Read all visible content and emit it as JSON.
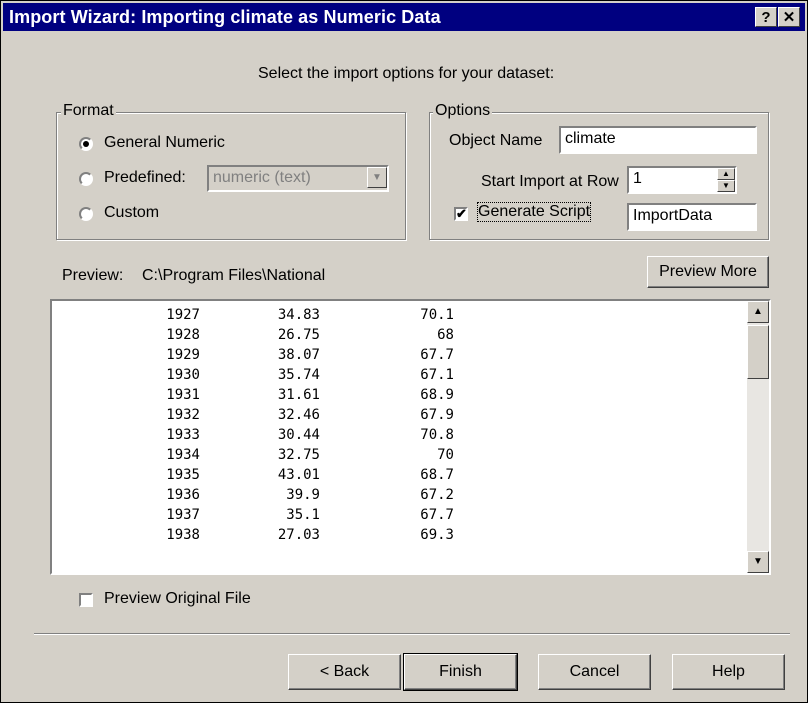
{
  "window": {
    "title": "Import Wizard: Importing climate as Numeric Data",
    "help_button": "?",
    "close_button": "✕"
  },
  "instructions": "Select the import options for your dataset:",
  "format": {
    "group_label": "Format",
    "options": [
      {
        "label": "General Numeric",
        "selected": true
      },
      {
        "label": "Predefined:",
        "selected": false
      },
      {
        "label": "Custom",
        "selected": false
      }
    ],
    "predefined_value": "numeric (text)"
  },
  "options": {
    "group_label": "Options",
    "object_name_label": "Object Name",
    "object_name_value": "climate",
    "start_row_label": "Start Import at Row",
    "start_row_value": "1",
    "generate_script_label": "Generate Script",
    "generate_script_checked": true,
    "script_name_value": "ImportData"
  },
  "preview": {
    "label": "Preview:",
    "path": "C:\\Program Files\\National",
    "more_button": "Preview More",
    "rows": [
      [
        "1927",
        "34.83",
        "70.1"
      ],
      [
        "1928",
        "26.75",
        "68"
      ],
      [
        "1929",
        "38.07",
        "67.7"
      ],
      [
        "1930",
        "35.74",
        "67.1"
      ],
      [
        "1931",
        "31.61",
        "68.9"
      ],
      [
        "1932",
        "32.46",
        "67.9"
      ],
      [
        "1933",
        "30.44",
        "70.8"
      ],
      [
        "1934",
        "32.75",
        "70"
      ],
      [
        "1935",
        "43.01",
        "68.7"
      ],
      [
        "1936",
        "39.9",
        "67.2"
      ],
      [
        "1937",
        "35.1",
        "67.7"
      ],
      [
        "1938",
        "27.03",
        "69.3"
      ]
    ],
    "original_file_label": "Preview Original File",
    "original_file_checked": false
  },
  "buttons": {
    "back": "< Back",
    "finish": "Finish",
    "cancel": "Cancel",
    "help": "Help"
  },
  "icons": {
    "radio_selected": "radio-dot",
    "checkmark": "✔",
    "dropdown": "▼",
    "spin_up": "▲",
    "spin_down": "▼",
    "scroll_up": "▲",
    "scroll_down": "▼"
  }
}
